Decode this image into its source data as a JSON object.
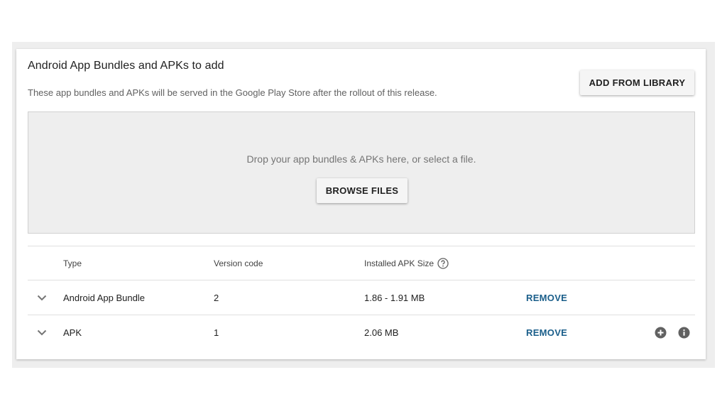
{
  "section": {
    "title": "Android App Bundles and APKs to add",
    "subtitle": "These app bundles and APKs will be served in the Google Play Store after the rollout of this release."
  },
  "buttons": {
    "add_from_library": "ADD FROM LIBRARY",
    "browse_files": "BROWSE FILES"
  },
  "dropzone": {
    "text": "Drop your app bundles & APKs here, or select a file."
  },
  "table": {
    "columns": [
      "Type",
      "Version code",
      "Installed APK Size"
    ],
    "rows": [
      {
        "type": "Android App Bundle",
        "version_code": "2",
        "size": "1.86 - 1.91 MB",
        "action": "REMOVE"
      },
      {
        "type": "APK",
        "version_code": "1",
        "size": "2.06 MB",
        "action": "REMOVE"
      }
    ]
  },
  "icons": {
    "expand": "chevron-down-icon",
    "help": "help-circle-icon",
    "add": "add-circle-icon",
    "info": "info-icon"
  },
  "colors": {
    "link": "#1a5e8a",
    "icon": "#616161"
  }
}
